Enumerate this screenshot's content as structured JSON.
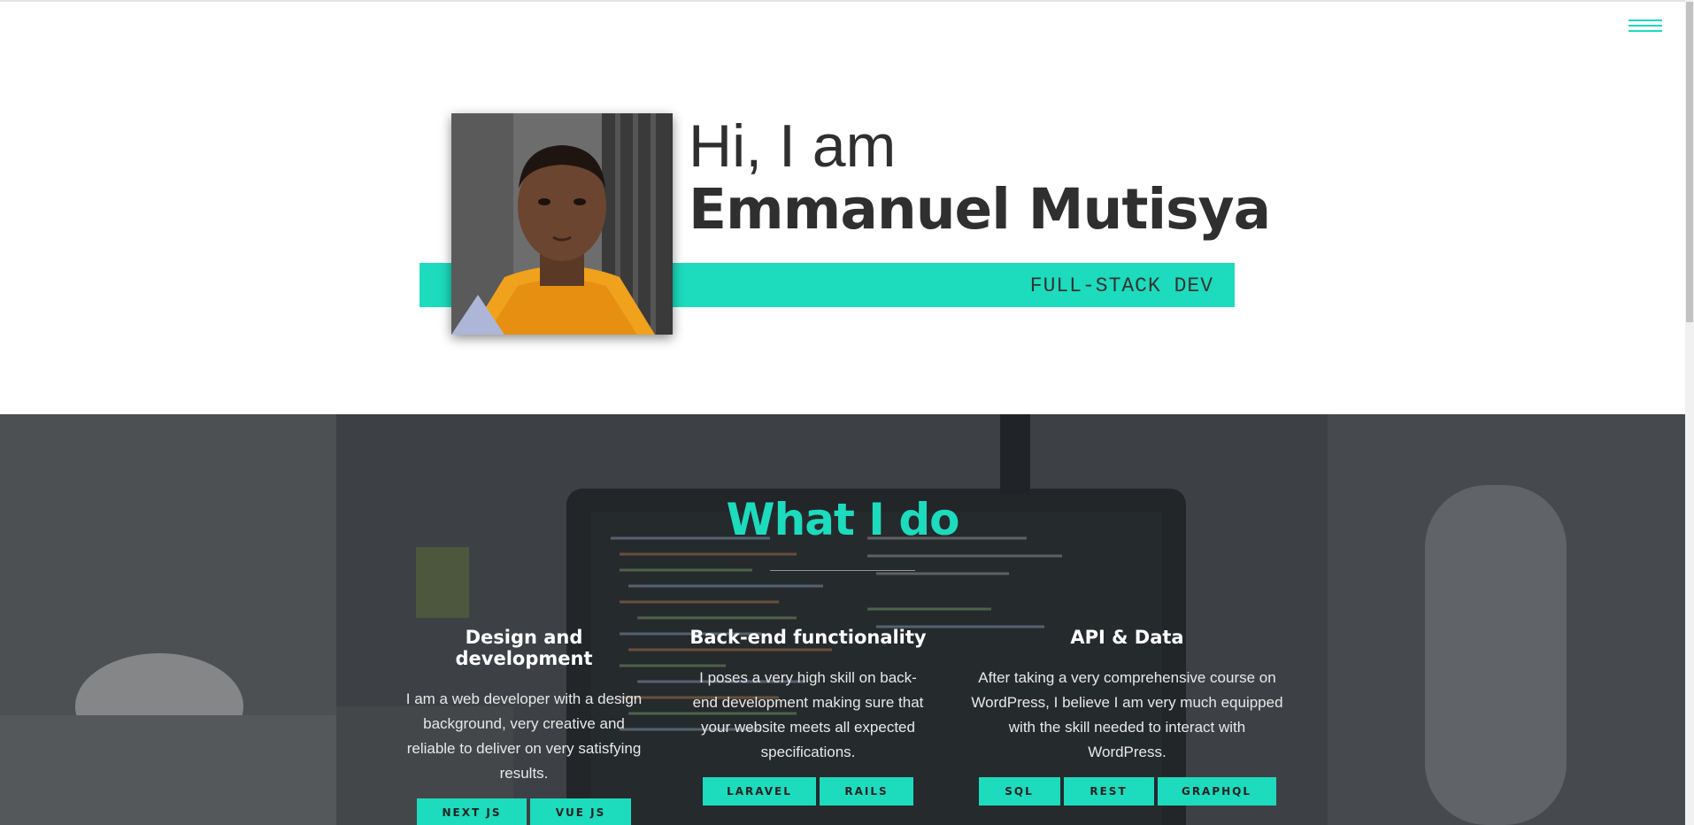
{
  "hero": {
    "greeting": "Hi, I am",
    "name": "Emmanuel Mutisya",
    "role": "FULL-STACK DEV"
  },
  "menu": {
    "icon": "hamburger-menu-icon"
  },
  "services": {
    "title": "What I do",
    "columns": [
      {
        "heading": "Design and development",
        "text": "I am a web developer with a design background, very creative and reliable to deliver on very satisfying results.",
        "chips": [
          "NEXT JS",
          "VUE JS"
        ]
      },
      {
        "heading": "Back-end functionality",
        "text": "I poses a very high skill on back-end development making sure that your website meets all expected specifications.",
        "chips": [
          "LARAVEL",
          "RAILS"
        ]
      },
      {
        "heading": "API & Data",
        "text": "After taking a very comprehensive course on WordPress, I believe I am very much equipped with the skill needed to interact with WordPress.",
        "chips": [
          "SQL",
          "REST",
          "GRAPHQL"
        ]
      }
    ]
  },
  "colors": {
    "accent": "#1ddbbd",
    "text_dark": "#2f2f2f"
  }
}
